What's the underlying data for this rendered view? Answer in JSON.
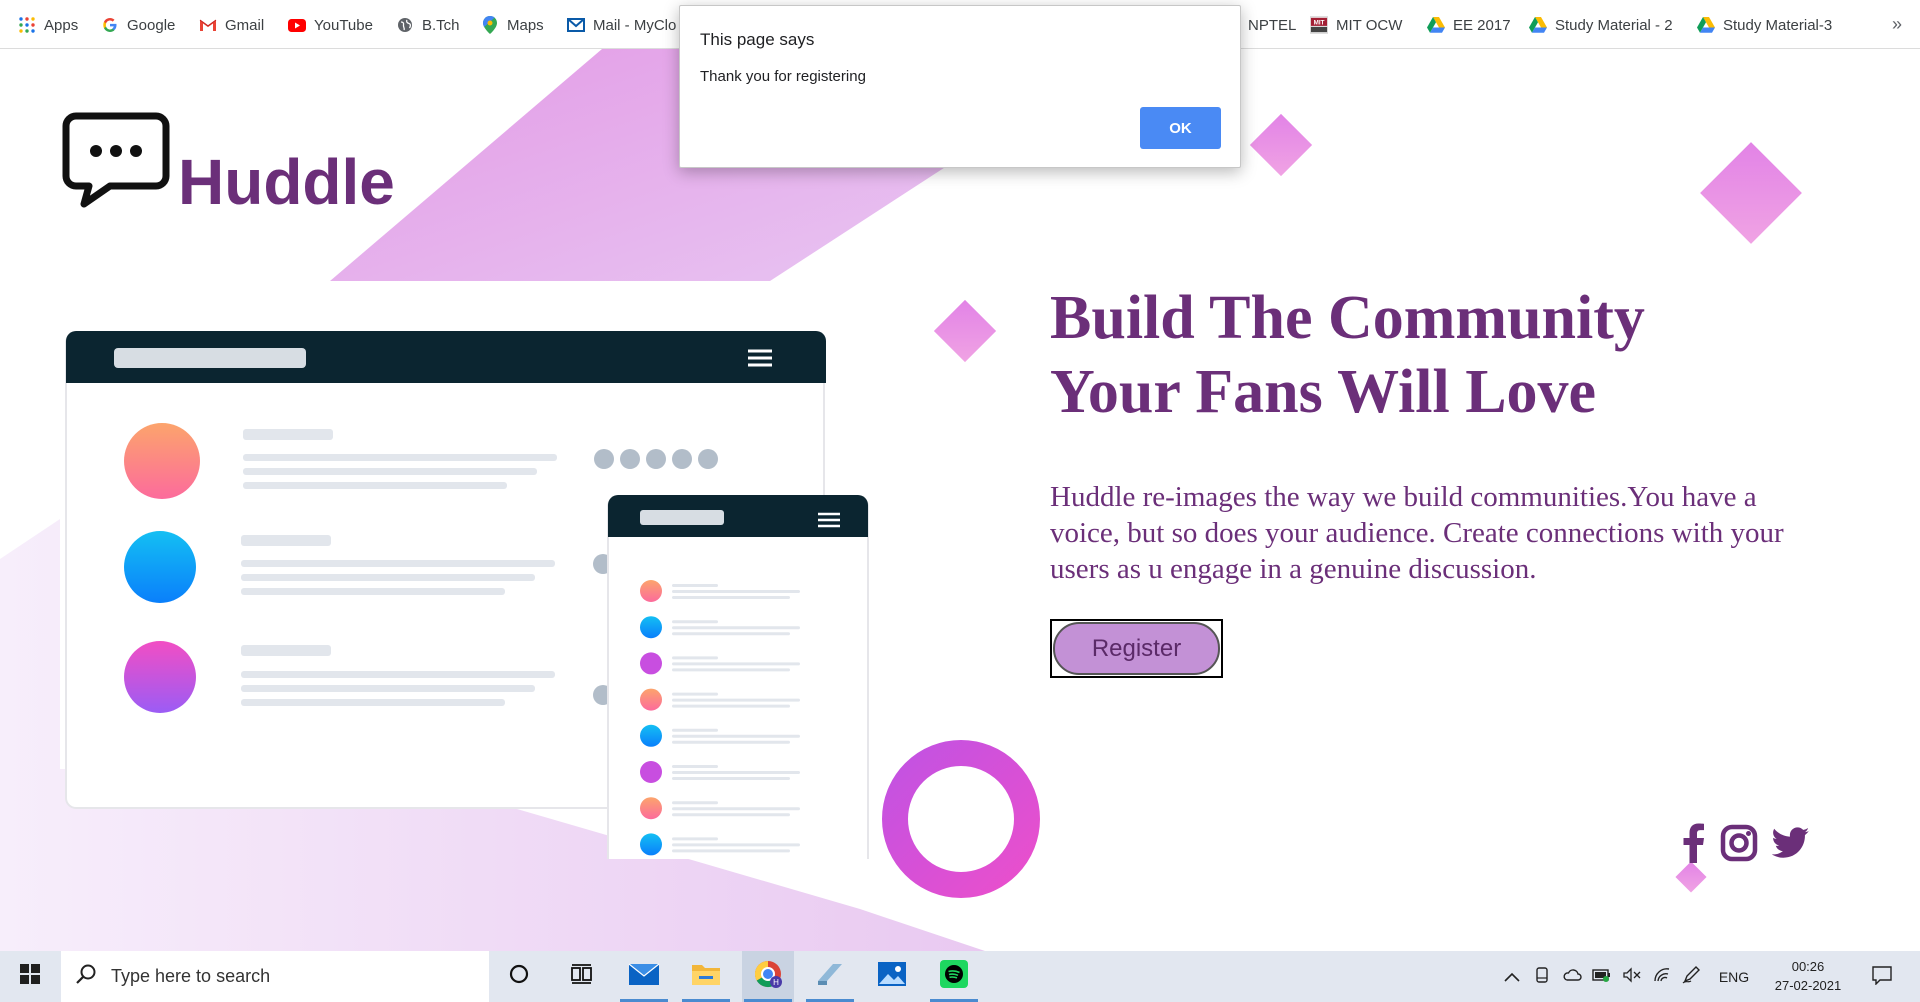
{
  "bookmarks": [
    {
      "label": "Apps",
      "icon": "apps-grid-icon"
    },
    {
      "label": "Google",
      "icon": "google-icon"
    },
    {
      "label": "Gmail",
      "icon": "gmail-icon"
    },
    {
      "label": "YouTube",
      "icon": "youtube-icon"
    },
    {
      "label": "B.Tch",
      "icon": "globe-icon"
    },
    {
      "label": "Maps",
      "icon": "maps-icon"
    },
    {
      "label": "Mail - MyClo",
      "icon": "outlook-mail-icon"
    },
    {
      "label": "NPTEL",
      "icon": "none"
    },
    {
      "label": "MIT OCW",
      "icon": "mit-ocw-icon"
    },
    {
      "label": "EE 2017",
      "icon": "google-drive-icon"
    },
    {
      "label": "Study Material - 2",
      "icon": "google-drive-icon"
    },
    {
      "label": "Study Material-3",
      "icon": "google-drive-icon"
    }
  ],
  "bookmarks_more": "»",
  "dialog": {
    "title": "This page says",
    "message": "Thank you for registering",
    "ok_label": "OK"
  },
  "site": {
    "logo_text": "Huddle",
    "headline_line1": "Build The Community",
    "headline_line2": "Your Fans Will Love",
    "description": "Huddle re-images the way we build communities.You have a voice, but so does your audience. Create connections with your users as u engage in a genuine discussion.",
    "register_label": "Register",
    "socials": [
      "facebook-icon",
      "instagram-icon",
      "twitter-icon"
    ]
  },
  "taskbar": {
    "search_placeholder": "Type here to search",
    "language": "ENG",
    "time": "00:26",
    "date": "27-02-2021"
  },
  "colors": {
    "brand_purple": "#6b2f79",
    "register_button": "#c391d6",
    "dialog_ok": "#4a8af4",
    "mockup_header": "#0b2530"
  }
}
